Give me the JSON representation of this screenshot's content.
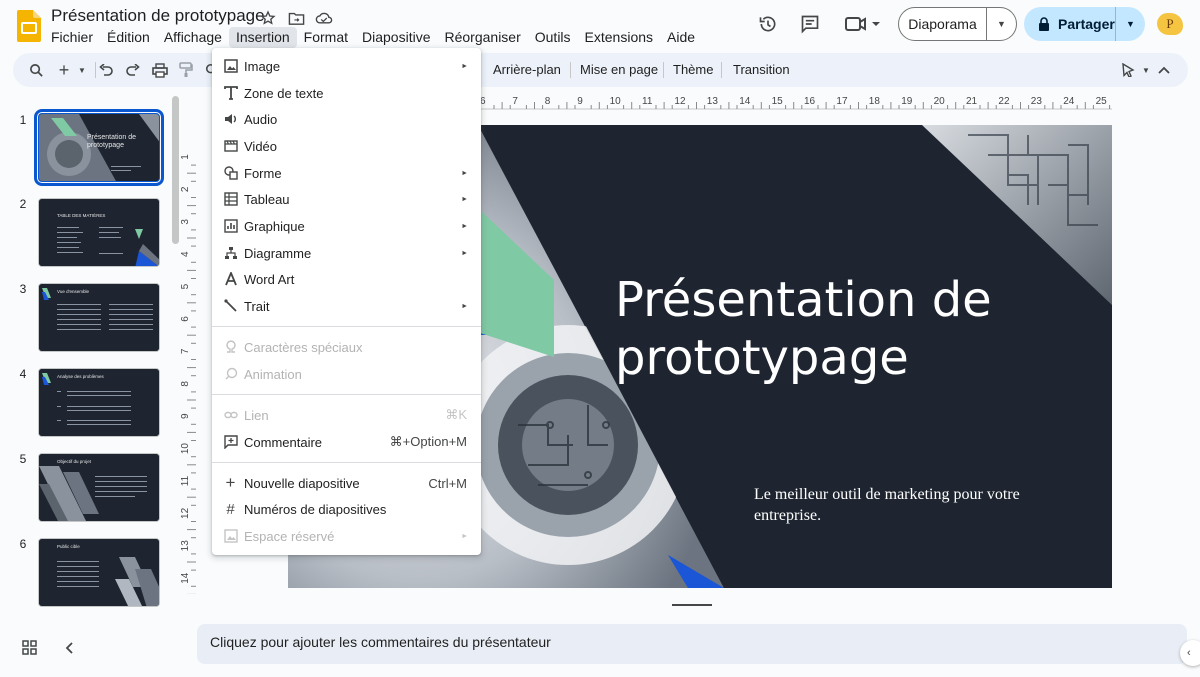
{
  "doc": {
    "title": "Présentation de prototypage"
  },
  "menubar": [
    "Fichier",
    "Édition",
    "Affichage",
    "Insertion",
    "Format",
    "Diapositive",
    "Réorganiser",
    "Outils",
    "Extensions",
    "Aide"
  ],
  "header": {
    "slideshow_label": "Diaporama",
    "share_label": "Partager",
    "avatar_initial": "P"
  },
  "toolbar": {
    "background": "Arrière-plan",
    "layout": "Mise en page",
    "theme": "Thème",
    "transition": "Transition"
  },
  "insert_menu": {
    "items": [
      {
        "label": "Image",
        "icon": "image-icon",
        "submenu": true
      },
      {
        "label": "Zone de texte",
        "icon": "text-box-icon"
      },
      {
        "label": "Audio",
        "icon": "audio-icon"
      },
      {
        "label": "Vidéo",
        "icon": "video-icon"
      },
      {
        "label": "Forme",
        "icon": "shape-icon",
        "submenu": true
      },
      {
        "label": "Tableau",
        "icon": "table-icon",
        "submenu": true
      },
      {
        "label": "Graphique",
        "icon": "chart-icon",
        "submenu": true
      },
      {
        "label": "Diagramme",
        "icon": "diagram-icon",
        "submenu": true
      },
      {
        "label": "Word Art",
        "icon": "word-art-icon"
      },
      {
        "label": "Trait",
        "icon": "line-icon",
        "submenu": true
      },
      {
        "label": "Caractères spéciaux",
        "icon": "special-chars-icon",
        "disabled": true
      },
      {
        "label": "Animation",
        "icon": "animation-icon",
        "disabled": true
      },
      {
        "label": "Lien",
        "icon": "link-icon",
        "shortcut": "⌘K",
        "disabled": true
      },
      {
        "label": "Commentaire",
        "icon": "comment-icon",
        "shortcut": "⌘+Option+M"
      },
      {
        "label": "Nouvelle diapositive",
        "icon": "plus-icon",
        "shortcut": "Ctrl+M"
      },
      {
        "label": "Numéros de diapositives",
        "icon": "hash-icon"
      },
      {
        "label": "Espace réservé",
        "icon": "placeholder-icon",
        "submenu": true,
        "disabled": true
      }
    ]
  },
  "filmstrip": {
    "slides": [
      {
        "number": "1",
        "title": "Présentation de prototypage"
      },
      {
        "number": "2",
        "title": "TABLE DES MATIÈRES"
      },
      {
        "number": "3",
        "title": "Vue d'ensemble"
      },
      {
        "number": "4",
        "title": "Analyse des problèmes"
      },
      {
        "number": "5",
        "title": "Objectif du projet"
      },
      {
        "number": "6",
        "title": "Public cible"
      }
    ]
  },
  "ruler": {
    "h_labels": [
      "6",
      "7",
      "8",
      "9",
      "10",
      "11",
      "12",
      "13",
      "14",
      "15",
      "16",
      "17",
      "18",
      "19",
      "20",
      "21",
      "22",
      "23",
      "24",
      "25"
    ],
    "v_labels": [
      "1",
      "2",
      "3",
      "4",
      "5",
      "6",
      "7",
      "8",
      "9",
      "10",
      "11",
      "12",
      "13",
      "14"
    ]
  },
  "slide": {
    "title": "Présentation de prototypage",
    "subtitle": "Le meilleur outil de marketing pour votre entreprise."
  },
  "notes": {
    "placeholder": "Cliquez pour ajouter les commentaires du présentateur"
  },
  "colors": {
    "slide_bg": "#1e2530",
    "accent_green": "#7fc9a4",
    "accent_blue": "#1a56d6",
    "share_bg": "#c2e7ff",
    "selection": "#0b57d0"
  }
}
